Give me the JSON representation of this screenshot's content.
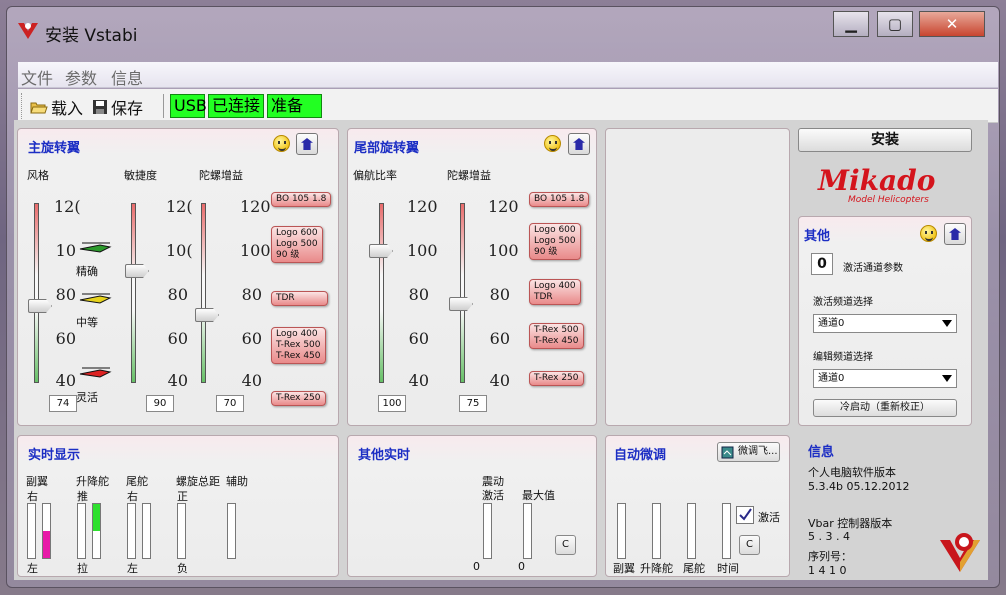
{
  "window": {
    "title": "安装 Vstabi",
    "min": "▁",
    "max": "▢",
    "close": "✕"
  },
  "menu": {
    "file": "文件",
    "params": "参数",
    "info": "信息"
  },
  "toolbar": {
    "load": "载入",
    "save": "保存",
    "usb": "USB",
    "connected": "已连接",
    "ready": "准备"
  },
  "main_rotor": {
    "title": "主旋转翼",
    "style_label": "风格",
    "agility_label": "敏捷度",
    "gyro_label": "陀螺增益",
    "ticks": [
      "120",
      "100",
      "80",
      "60",
      "40"
    ],
    "style_ticks": [
      "12(",
      "10",
      "80",
      "60",
      "40"
    ],
    "agility_ticks": [
      "12(",
      "10(",
      "80",
      "60",
      "40"
    ],
    "style_modes": [
      "精确",
      "中等",
      "灵活"
    ],
    "style_value": "74",
    "agility_value": "90",
    "gyro_value": "70",
    "tags": [
      "BO 105 1.8",
      "Logo 600\nLogo 500\n90 级",
      "TDR",
      "Logo 400\nT-Rex 500\nT-Rex 450",
      "T-Rex 250"
    ]
  },
  "tail_rotor": {
    "title": "尾部旋转翼",
    "yaw_label": "偏航比率",
    "gyro_label": "陀螺增益",
    "ticks": [
      "120",
      "100",
      "80",
      "60",
      "40"
    ],
    "yaw_value": "100",
    "gyro_value": "75",
    "tags": [
      "BO 105 1.8",
      "Logo 600\nLogo 500\n90 级",
      "Logo 400\nTDR",
      "T-Rex 500\nT-Rex 450",
      "T-Rex 250"
    ]
  },
  "right": {
    "install_button": "安装",
    "logo_text": "Mikado",
    "logo_sub": "Model Helicopters",
    "other_title": "其他",
    "activate_param_value": "0",
    "activate_param_label": "激活通道参数",
    "active_channel_label": "激活频道选择",
    "active_channel_value": "通道0",
    "edit_channel_label": "编辑频道选择",
    "edit_channel_value": "通道0",
    "cold_start_button": "冷启动（重新校正）"
  },
  "realtime": {
    "title": "实时显示",
    "aileron": "副翼",
    "elevator": "升降舵",
    "rudder": "尾舵",
    "pitch": "螺旋总距",
    "aux": "辅助",
    "right_lbl": "右",
    "push_lbl": "推",
    "right_lbl2": "右",
    "pos_lbl": "正",
    "left_lbl": "左",
    "pull_lbl": "拉",
    "left_lbl2": "左",
    "neg_lbl": "负",
    "aileron_level": 0.5,
    "elevator_level": 0.5
  },
  "other_realtime": {
    "title": "其他实时",
    "vibration": "震动",
    "active": "激活",
    "max": "最大值",
    "val1": "0",
    "val2": "0",
    "clear": "C"
  },
  "autotune": {
    "title": "自动微调",
    "tune_button": "微调飞...",
    "activate": "激活",
    "clear": "C",
    "aileron": "副翼",
    "elevator": "升降舵",
    "rudder": "尾舵",
    "time": "时间"
  },
  "info": {
    "title": "信息",
    "pc_version_label": "个人电脑软件版本",
    "pc_version": "5.3.4b  05.12.2012",
    "vbar_label": "Vbar 控制器版本",
    "vbar_version": "5 . 3 . 4",
    "serial_label": "序列号：",
    "serial": "1 4 1 0"
  },
  "colors": {
    "accent": "#1c2ec4",
    "status_green": "#22ff22",
    "aileron_fill": "#e81aa8",
    "elevator_fill": "#2ee02e"
  }
}
